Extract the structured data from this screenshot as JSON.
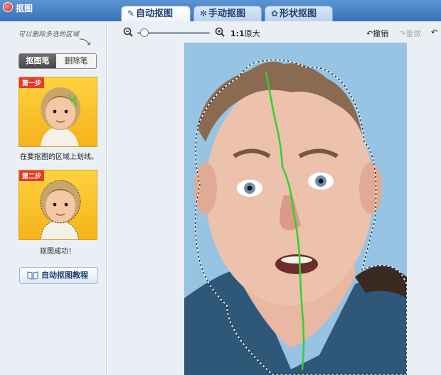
{
  "app": {
    "title": "抠图"
  },
  "tabs": [
    {
      "label": "自动抠图",
      "icon": "brush-icon",
      "active": true
    },
    {
      "label": "手动抠图",
      "icon": "gear-icon",
      "active": false
    },
    {
      "label": "形状抠图",
      "icon": "shape-icon",
      "active": false
    }
  ],
  "left_panel": {
    "hint": "可以删除多选的区域",
    "brushes": {
      "cutout": "抠图笔",
      "erase": "删除笔"
    },
    "step1": {
      "tag": "第一步",
      "caption": "在要抠图的区域上划线。"
    },
    "step2": {
      "tag": "第二步",
      "caption": "抠图成功！"
    },
    "tutorial_button": "自动抠图教程"
  },
  "toolbar": {
    "zoom_level": 0.1,
    "actual_size_ratio": "1:1",
    "actual_size_label": "原大",
    "undo_label": "撤销",
    "redo_label": "重做"
  },
  "colors": {
    "stroke": "#2fd12f",
    "background": "#96c4e2",
    "step_bg": "#f5b31b",
    "step_tag": "#e53c2a"
  }
}
